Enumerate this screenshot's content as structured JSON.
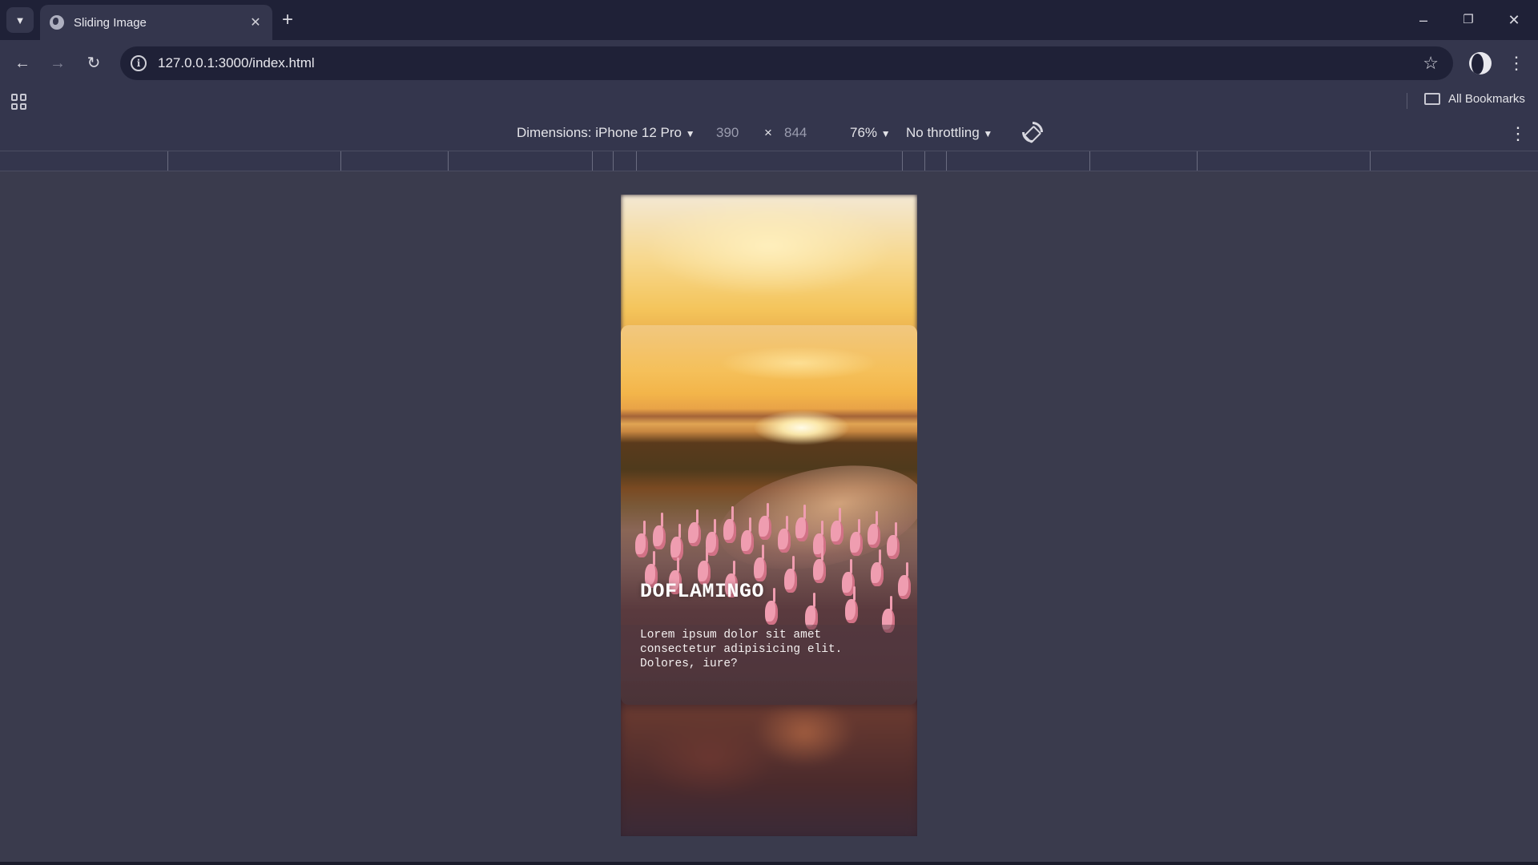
{
  "browser": {
    "tab": {
      "title": "Sliding Image",
      "close_glyph": "✕"
    },
    "new_tab_glyph": "+",
    "address": {
      "url": "127.0.0.1:3000/index.html"
    },
    "bookmarks": {
      "all_label": "All Bookmarks"
    },
    "window_controls": {
      "minimize": "–",
      "restore": "❐",
      "close": "✕"
    },
    "icons": [
      "tab-search-icon",
      "favicon-globe-icon",
      "back-icon",
      "forward-icon",
      "reload-icon",
      "site-info-icon",
      "star-icon",
      "profile-avatar",
      "menu-icon",
      "apps-icon",
      "folder-icon"
    ]
  },
  "devtools": {
    "dimensions_label": "Dimensions: iPhone 12 Pro",
    "width": "390",
    "times": "×",
    "height": "844",
    "zoom": "76%",
    "throttling": "No throttling"
  },
  "page": {
    "card": {
      "title": "DOFLAMINGO",
      "description": "Lorem ipsum dolor sit amet consectetur adipisicing elit. Dolores, iure?"
    }
  },
  "colors": {
    "chrome_dark": "#1f2137",
    "chrome": "#34364d",
    "page_bg": "#3a3b4d"
  }
}
